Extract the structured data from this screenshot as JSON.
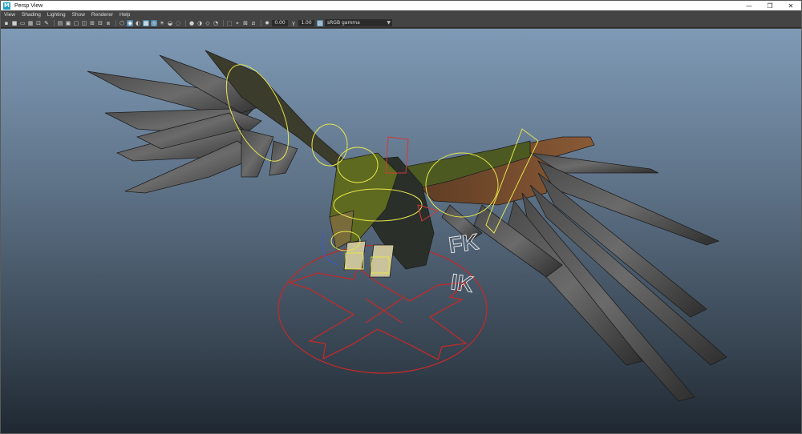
{
  "window": {
    "title": "Persp View"
  },
  "app_icon": "M",
  "window_controls": {
    "minimize": "—",
    "restore": "❐",
    "close": "✕"
  },
  "menu": [
    "View",
    "Shading",
    "Lighting",
    "Show",
    "Renderer",
    "Help"
  ],
  "toolbar": {
    "exposure_value": "0.00",
    "gamma_value": "1.00",
    "color_space": "sRGB gamma"
  },
  "viewport": {
    "labels": {
      "fk": "FK",
      "ik": "IK"
    }
  }
}
